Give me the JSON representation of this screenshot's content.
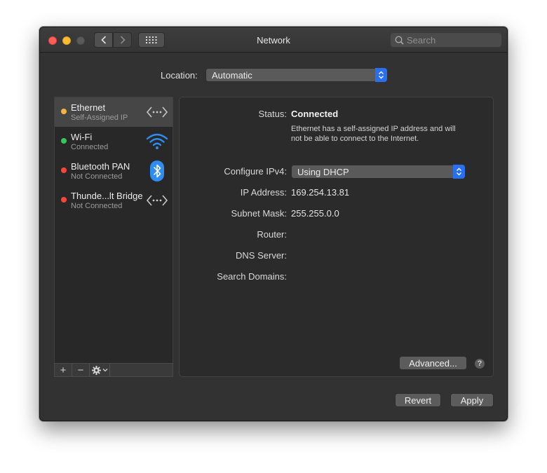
{
  "window": {
    "title": "Network",
    "search_placeholder": "Search"
  },
  "location": {
    "label": "Location:",
    "value": "Automatic"
  },
  "services": [
    {
      "name": "Ethernet",
      "status": "Self-Assigned IP",
      "dot_color": "#f5b53f",
      "icon": "ethernet-arrows-icon"
    },
    {
      "name": "Wi-Fi",
      "status": "Connected",
      "dot_color": "#35c759",
      "icon": "wifi-icon"
    },
    {
      "name": "Bluetooth PAN",
      "status": "Not Connected",
      "dot_color": "#ff453a",
      "icon": "bluetooth-icon"
    },
    {
      "name": "Thunde...lt Bridge",
      "status": "Not Connected",
      "dot_color": "#ff453a",
      "icon": "ethernet-arrows-icon"
    }
  ],
  "sidebar_toolbar": {
    "add": "+",
    "remove": "−"
  },
  "detail": {
    "status_label": "Status:",
    "status_value": "Connected",
    "status_description": "Ethernet has a self-assigned IP address and will not be able to connect to the Internet.",
    "configure_label": "Configure IPv4:",
    "configure_value": "Using DHCP",
    "ip_label": "IP Address:",
    "ip_value": "169.254.13.81",
    "subnet_label": "Subnet Mask:",
    "subnet_value": "255.255.0.0",
    "router_label": "Router:",
    "router_value": "",
    "dns_label": "DNS Server:",
    "dns_value": "",
    "search_domains_label": "Search Domains:",
    "search_domains_value": "",
    "advanced_label": "Advanced...",
    "help_label": "?"
  },
  "footer": {
    "revert_label": "Revert",
    "apply_label": "Apply"
  },
  "colors": {
    "accent": "#2a6ff0",
    "window_bg": "#323232"
  }
}
